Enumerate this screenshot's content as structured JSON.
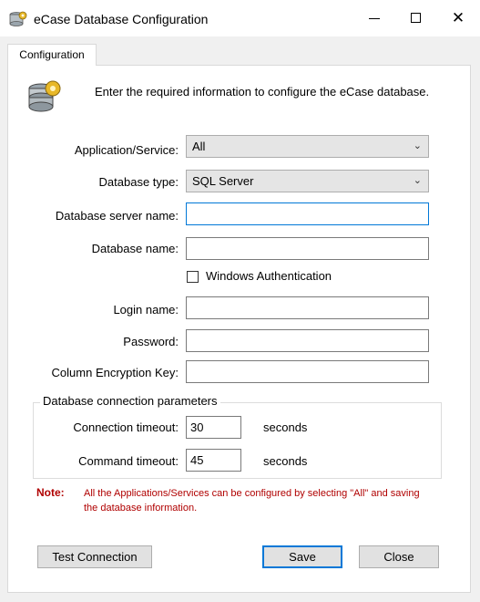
{
  "window": {
    "title": "eCase Database Configuration",
    "minimize_glyph": "—",
    "maximize_glyph": "☐",
    "close_glyph": "✕"
  },
  "tab": {
    "label": "Configuration"
  },
  "intro_text": "Enter the required information to configure the eCase database.",
  "fields": {
    "application_service": {
      "label": "Application/Service:",
      "value": "All"
    },
    "database_type": {
      "label": "Database type:",
      "value": "SQL Server"
    },
    "database_server_name": {
      "label": "Database server name:",
      "value": ""
    },
    "database_name": {
      "label": "Database name:",
      "value": ""
    },
    "windows_authentication": {
      "label": "Windows Authentication",
      "checked": false
    },
    "login_name": {
      "label": "Login name:",
      "value": ""
    },
    "password": {
      "label": "Password:",
      "value": ""
    },
    "column_encryption_key": {
      "label": "Column Encryption Key:",
      "value": ""
    }
  },
  "connection_params": {
    "title": "Database connection parameters",
    "connection_timeout": {
      "label": "Connection timeout:",
      "value": "30",
      "unit": "seconds"
    },
    "command_timeout": {
      "label": "Command timeout:",
      "value": "45",
      "unit": "seconds"
    }
  },
  "note": {
    "label": "Note:",
    "text": "All the Applications/Services can be configured by selecting \"All\" and saving the database information."
  },
  "buttons": {
    "test_connection": "Test Connection",
    "save": "Save",
    "close": "Close"
  },
  "colors": {
    "accent": "#0078d7",
    "note": "#b00000"
  }
}
